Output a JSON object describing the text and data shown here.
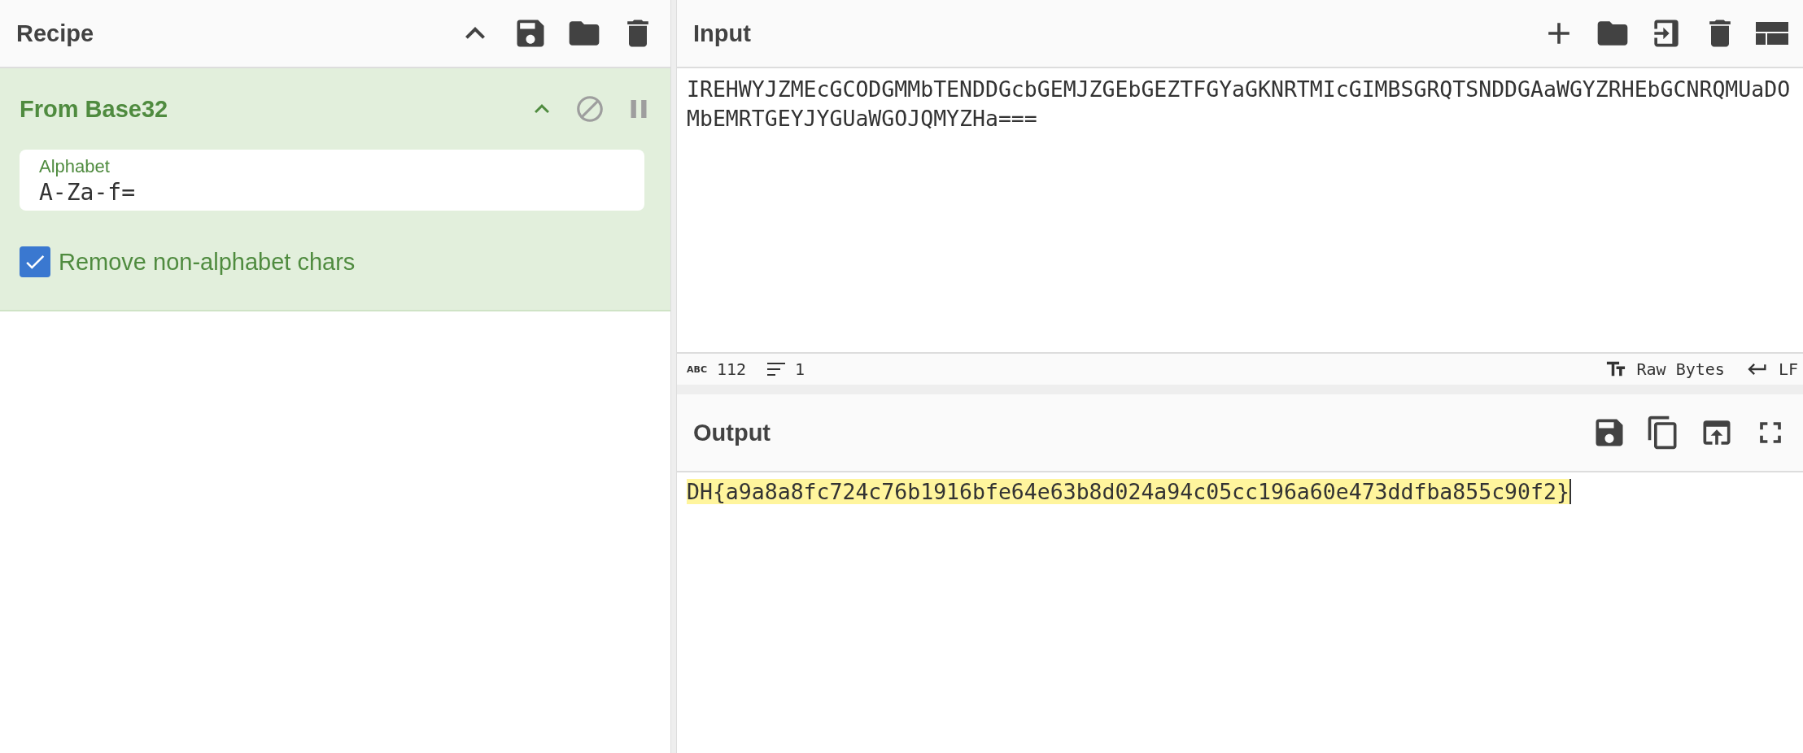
{
  "recipe": {
    "title": "Recipe",
    "operations": [
      {
        "name": "From Base32",
        "fields": [
          {
            "kind": "text",
            "label": "Alphabet",
            "value": "A-Za-f="
          },
          {
            "kind": "checkbox",
            "label": "Remove non-alphabet chars",
            "checked": true
          }
        ]
      }
    ]
  },
  "input": {
    "title": "Input",
    "text": "IREHWYJZMEcGCODGMMbTENDDGcbGEMJZGEbGEZTFGYaGKNRTMIcGIMBSGRQTSNDDGAaWGYZRHEbGCNRQMUaDOMbEMRTGEYJYGUaWGOJQMYZHa===",
    "status": {
      "length_label": "ABC",
      "length": "112",
      "lines": "1",
      "encoding": "Raw Bytes",
      "eol": "LF"
    }
  },
  "output": {
    "title": "Output",
    "text": "DH{a9a8a8fc724c76b1916bfe64e63b8d024a94c05cc196a60e473ddfba855c90f2}",
    "highlighted": true
  }
}
